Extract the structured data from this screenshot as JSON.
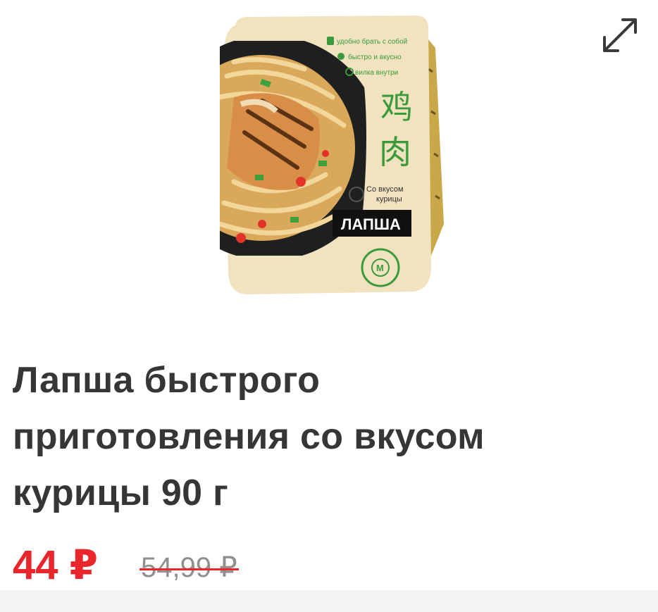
{
  "image": {
    "alt": "Лапша быстрого приготовления со вкусом курицы 90 г",
    "package": {
      "feature_1": "удобно брать с собой",
      "feature_2": "быстро и вкусно",
      "feature_3": "вилка внутри",
      "hanzi_1": "鸡",
      "hanzi_2": "肉",
      "flavor_line_1": "Со вкусом",
      "flavor_line_2": "курицы",
      "name_band": "ЛАПША",
      "badge": "М"
    }
  },
  "expand": {
    "icon": "expand-diagonal-icon"
  },
  "product": {
    "title_lines": [
      "Лапша быстрого",
      "приготовления со вкусом",
      "курицы 90 г"
    ]
  },
  "price": {
    "current": "44 ₽",
    "old": "54,99 ₽"
  },
  "colors": {
    "price_current": "#e8262c",
    "price_old": "#8f8f8f",
    "title": "#363636",
    "package_beige": "#f1e3bf",
    "package_green": "#3a9a3c",
    "package_bowl": "#1e1f1f"
  }
}
